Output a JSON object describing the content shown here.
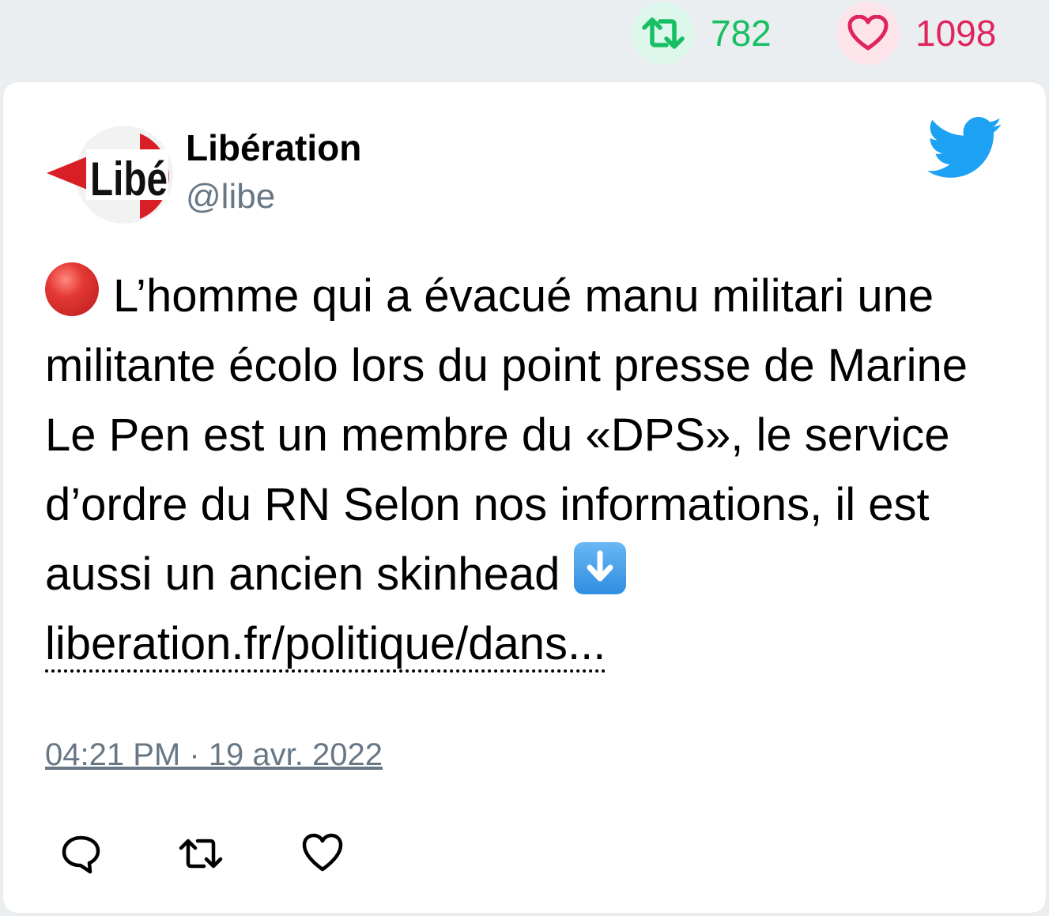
{
  "stats": {
    "retweets": "782",
    "likes": "1098"
  },
  "colors": {
    "retweet": "#17bf63",
    "like": "#e0245e",
    "twitter_blue": "#1da1f2",
    "handle_gray": "#687785"
  },
  "tweet": {
    "author": {
      "name": "Libération",
      "handle": "@libe",
      "avatar_logo_text": "Libé"
    },
    "text_main": "L’homme qui a évacué manu militari une militante écolo lors du point presse de Marine Le Pen est un membre du «DPS», le service d’ordre du RN Selon nos informations, il est aussi un ancien skinhead",
    "link_text": "liberation.fr/politique/dans...",
    "timestamp": "04:21 PM · 19 avr. 2022",
    "icons": {
      "lead_emoji": "red-circle-icon",
      "trail_emoji": "down-arrow-icon",
      "brand": "twitter-bird-icon"
    }
  },
  "actions": {
    "reply": "reply-icon",
    "retweet": "retweet-icon",
    "like": "heart-icon"
  }
}
